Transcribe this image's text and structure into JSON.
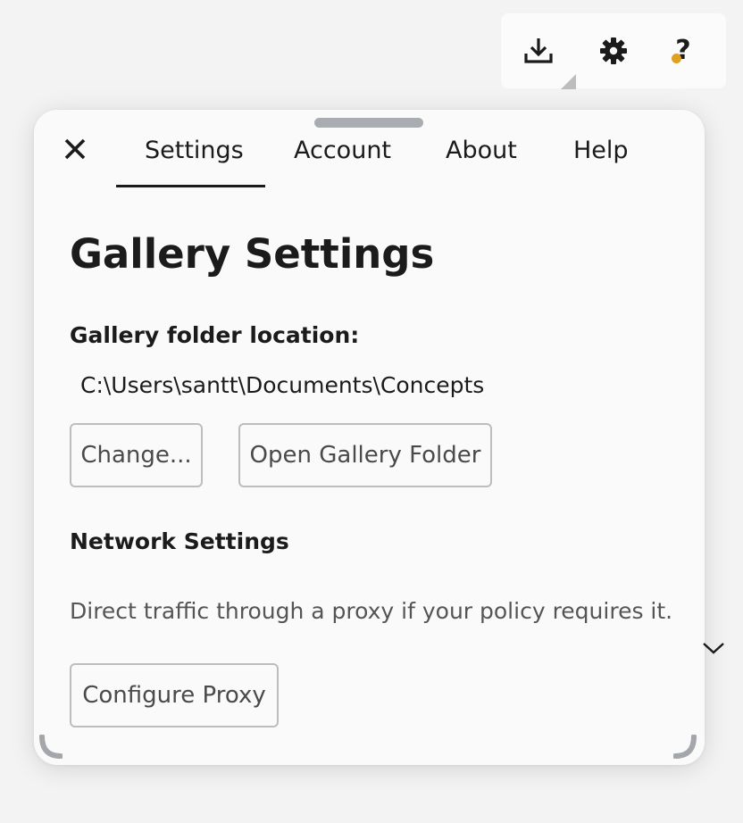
{
  "toolbar": {
    "download_icon": "download-icon",
    "gear_icon": "gear-icon",
    "help_icon": "help-icon",
    "help_glyph": "?",
    "notification_color": "#e0a020"
  },
  "tabs": [
    {
      "label": "Settings",
      "active": true
    },
    {
      "label": "Account",
      "active": false
    },
    {
      "label": "About",
      "active": false
    },
    {
      "label": "Help",
      "active": false
    }
  ],
  "main": {
    "title": "Gallery Settings",
    "gallery": {
      "label": "Gallery folder location:",
      "path": "C:\\Users\\santt\\Documents\\Concepts",
      "change_button": "Change...",
      "open_button": "Open Gallery Folder"
    },
    "network": {
      "label": "Network Settings",
      "description": "Direct traffic through a proxy if your policy requires it.",
      "configure_button": "Configure Proxy",
      "expanded": true
    }
  },
  "colors": {
    "background": "#f3f3f3",
    "panel": "#fafafa",
    "text": "#1b1b1b",
    "accent_dot": "#e0a020"
  }
}
